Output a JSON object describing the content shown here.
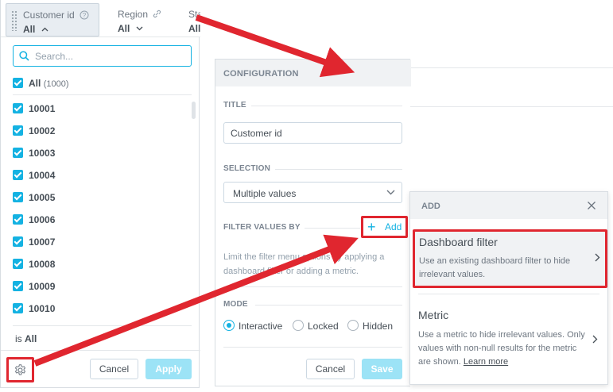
{
  "filter_bar": {
    "customer": {
      "name": "Customer id",
      "value": "All"
    },
    "region": {
      "name": "Region",
      "value": "All"
    },
    "state": {
      "name": "Sta",
      "value": "All"
    }
  },
  "dropdown": {
    "search_placeholder": "Search...",
    "all_label": "All",
    "all_count": "(1000)",
    "items": [
      "10001",
      "10002",
      "10003",
      "10004",
      "10005",
      "10006",
      "10007",
      "10008",
      "10009",
      "10010"
    ],
    "is_prefix": "is",
    "is_value": "All",
    "cancel_label": "Cancel",
    "apply_label": "Apply"
  },
  "config": {
    "header": "CONFIGURATION",
    "title_label": "TITLE",
    "title_value": "Customer id",
    "selection_label": "SELECTION",
    "selection_value": "Multiple values",
    "filter_values_label": "FILTER VALUES BY",
    "add_label": "Add",
    "help_text": "Limit the filter menu options by applying a dashboard filter or adding a metric.",
    "mode_label": "MODE",
    "modes": [
      "Interactive",
      "Locked",
      "Hidden"
    ],
    "selected_mode": "Interactive",
    "cancel_label": "Cancel",
    "save_label": "Save"
  },
  "add_panel": {
    "header": "ADD",
    "options": [
      {
        "title": "Dashboard filter",
        "description": "Use an existing dashboard filter to hide irrelevant values."
      },
      {
        "title": "Metric",
        "description": "Use a metric to hide irrelevant values. Only values with non-null results for the metric are shown.",
        "link": "Learn more"
      }
    ]
  },
  "colors": {
    "accent": "#14b2e2",
    "highlight": "#e0262f",
    "primary_disabled": "#9ce3f6"
  }
}
